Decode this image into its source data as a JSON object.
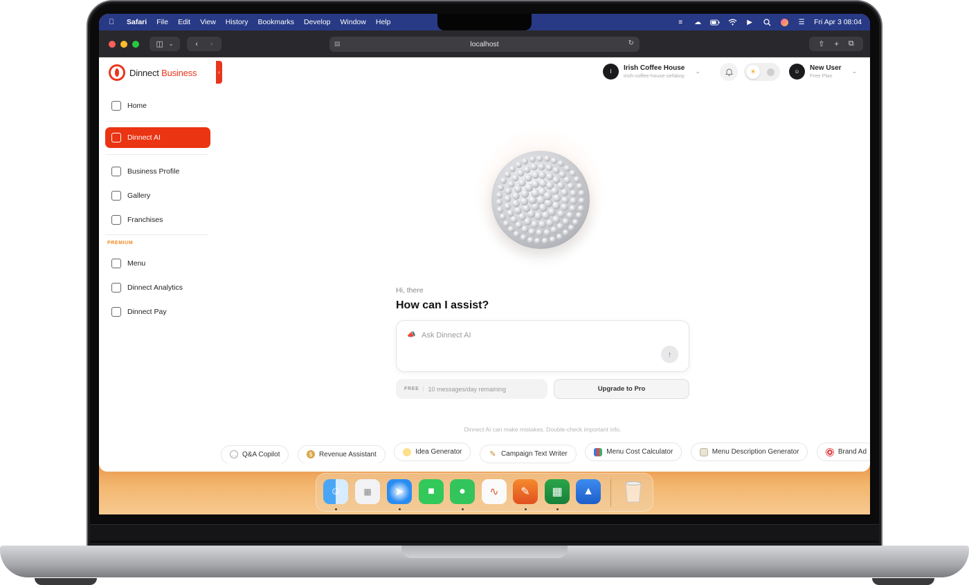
{
  "menubar": {
    "app": "Safari",
    "items": [
      "File",
      "Edit",
      "View",
      "History",
      "Bookmarks",
      "Develop",
      "Window",
      "Help"
    ],
    "datetime": "Fri Apr 3  08:04"
  },
  "browser": {
    "address": "localhost"
  },
  "brand": {
    "name": "Dinnect",
    "suffix": "Business",
    "accent": "#ea3412"
  },
  "sidebar": {
    "items": [
      {
        "label": "Home",
        "icon": "home-icon"
      },
      {
        "label": "Dinnect AI",
        "icon": "ai-icon",
        "active": true
      },
      {
        "label": "Business Profile",
        "icon": "building-icon"
      },
      {
        "label": "Gallery",
        "icon": "grid-icon"
      },
      {
        "label": "Franchises",
        "icon": "network-icon"
      }
    ],
    "premium_label": "PREMIUM",
    "premium_items": [
      {
        "label": "Menu",
        "icon": "utensils-icon"
      },
      {
        "label": "Dinnect Analytics",
        "icon": "chart-icon"
      },
      {
        "label": "Dinnect Pay",
        "icon": "card-icon"
      }
    ]
  },
  "header": {
    "business": {
      "initial": "I",
      "name": "Irish Coffee House",
      "slug": "irish-coffee-house-sefakoy"
    },
    "user": {
      "name": "New User",
      "plan": "Free Plan"
    }
  },
  "chat": {
    "greeting": "Hi, there",
    "heading": "How can I assist?",
    "placeholder": "Ask Dinnect AI",
    "free_badge": "FREE",
    "remaining": "10 messages/day remaining",
    "upgrade_label": "Upgrade to Pro",
    "disclaimer": "Dinnect AI can make mistakes. Double-check important info."
  },
  "tools": [
    {
      "label": "Q&A Copilot",
      "icon": "speech-bubble-icon"
    },
    {
      "label": "Revenue Assistant",
      "icon": "money-bag-icon"
    },
    {
      "label": "Idea Generator",
      "icon": "lightbulb-icon"
    },
    {
      "label": "Campaign Text Writer",
      "icon": "pencil-icon"
    },
    {
      "label": "Menu Cost Calculator",
      "icon": "bar-chart-icon"
    },
    {
      "label": "Menu Description Generator",
      "icon": "notepad-icon"
    },
    {
      "label": "Brand Ad",
      "icon": "target-icon"
    }
  ],
  "dock": [
    "Finder",
    "Launchpad",
    "Safari",
    "FaceTime",
    "Messages",
    "Freeform",
    "Pages",
    "Numbers",
    "Keynote",
    "Trash"
  ]
}
